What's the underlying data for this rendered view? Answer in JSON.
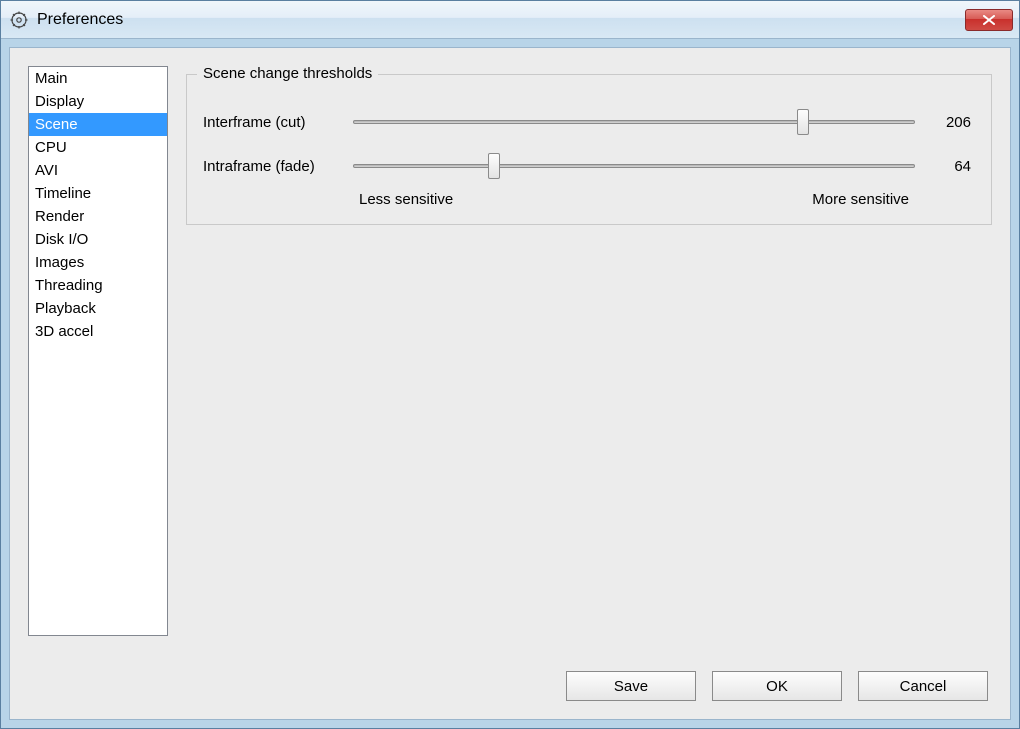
{
  "window": {
    "title": "Preferences"
  },
  "sidebar": {
    "items": [
      {
        "label": "Main"
      },
      {
        "label": "Display"
      },
      {
        "label": "Scene"
      },
      {
        "label": "CPU"
      },
      {
        "label": "AVI"
      },
      {
        "label": "Timeline"
      },
      {
        "label": "Render"
      },
      {
        "label": "Disk I/O"
      },
      {
        "label": "Images"
      },
      {
        "label": "Threading"
      },
      {
        "label": "Playback"
      },
      {
        "label": "3D accel"
      }
    ],
    "selected_index": 2
  },
  "panel": {
    "group_title": "Scene change thresholds",
    "sliders": {
      "interframe": {
        "label": "Interframe (cut)",
        "value": "206",
        "percent": 80
      },
      "intraframe": {
        "label": "Intraframe (fade)",
        "value": "64",
        "percent": 25
      }
    },
    "less_label": "Less sensitive",
    "more_label": "More sensitive"
  },
  "buttons": {
    "save": "Save",
    "ok": "OK",
    "cancel": "Cancel"
  }
}
